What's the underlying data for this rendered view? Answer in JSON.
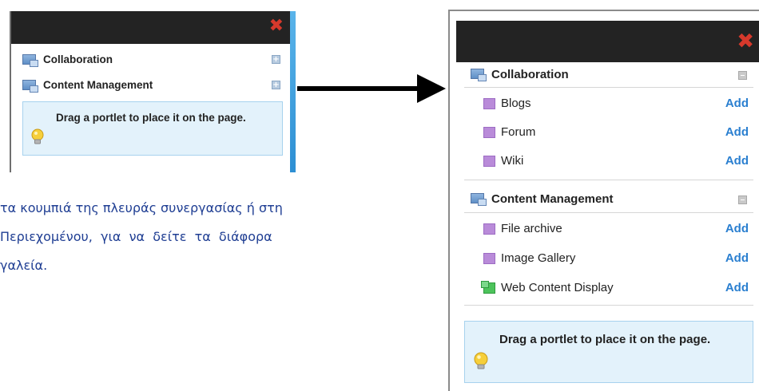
{
  "small_panel": {
    "close_symbol": "✖",
    "categories": [
      {
        "label": "Collaboration",
        "toggle": "+"
      },
      {
        "label": "Content Management",
        "toggle": "+"
      }
    ],
    "info_text": "Drag a portlet to place it on the page."
  },
  "paragraph": {
    "lines": [
      "τα κουμπιά της πλευράς συνεργασίας ή στη",
      "Περιεχομένου,  για  να  δείτε  τα  διάφορα",
      "γαλεία."
    ]
  },
  "big_panel": {
    "close_symbol": "✖",
    "collaboration": {
      "label": "Collaboration",
      "items": [
        {
          "label": "Blogs",
          "action": "Add"
        },
        {
          "label": "Forum",
          "action": "Add"
        },
        {
          "label": "Wiki",
          "action": "Add"
        }
      ]
    },
    "content_management": {
      "label": "Content Management",
      "items": [
        {
          "label": "File archive",
          "action": "Add"
        },
        {
          "label": "Image Gallery",
          "action": "Add"
        },
        {
          "label": "Web Content Display",
          "action": "Add"
        }
      ]
    },
    "info_text": "Drag a portlet to place it on the page."
  },
  "colors": {
    "close_red": "#d6392c",
    "link_blue": "#2a7fd0",
    "greek_text": "#1f3e93",
    "info_bg": "#e3f2fb"
  }
}
